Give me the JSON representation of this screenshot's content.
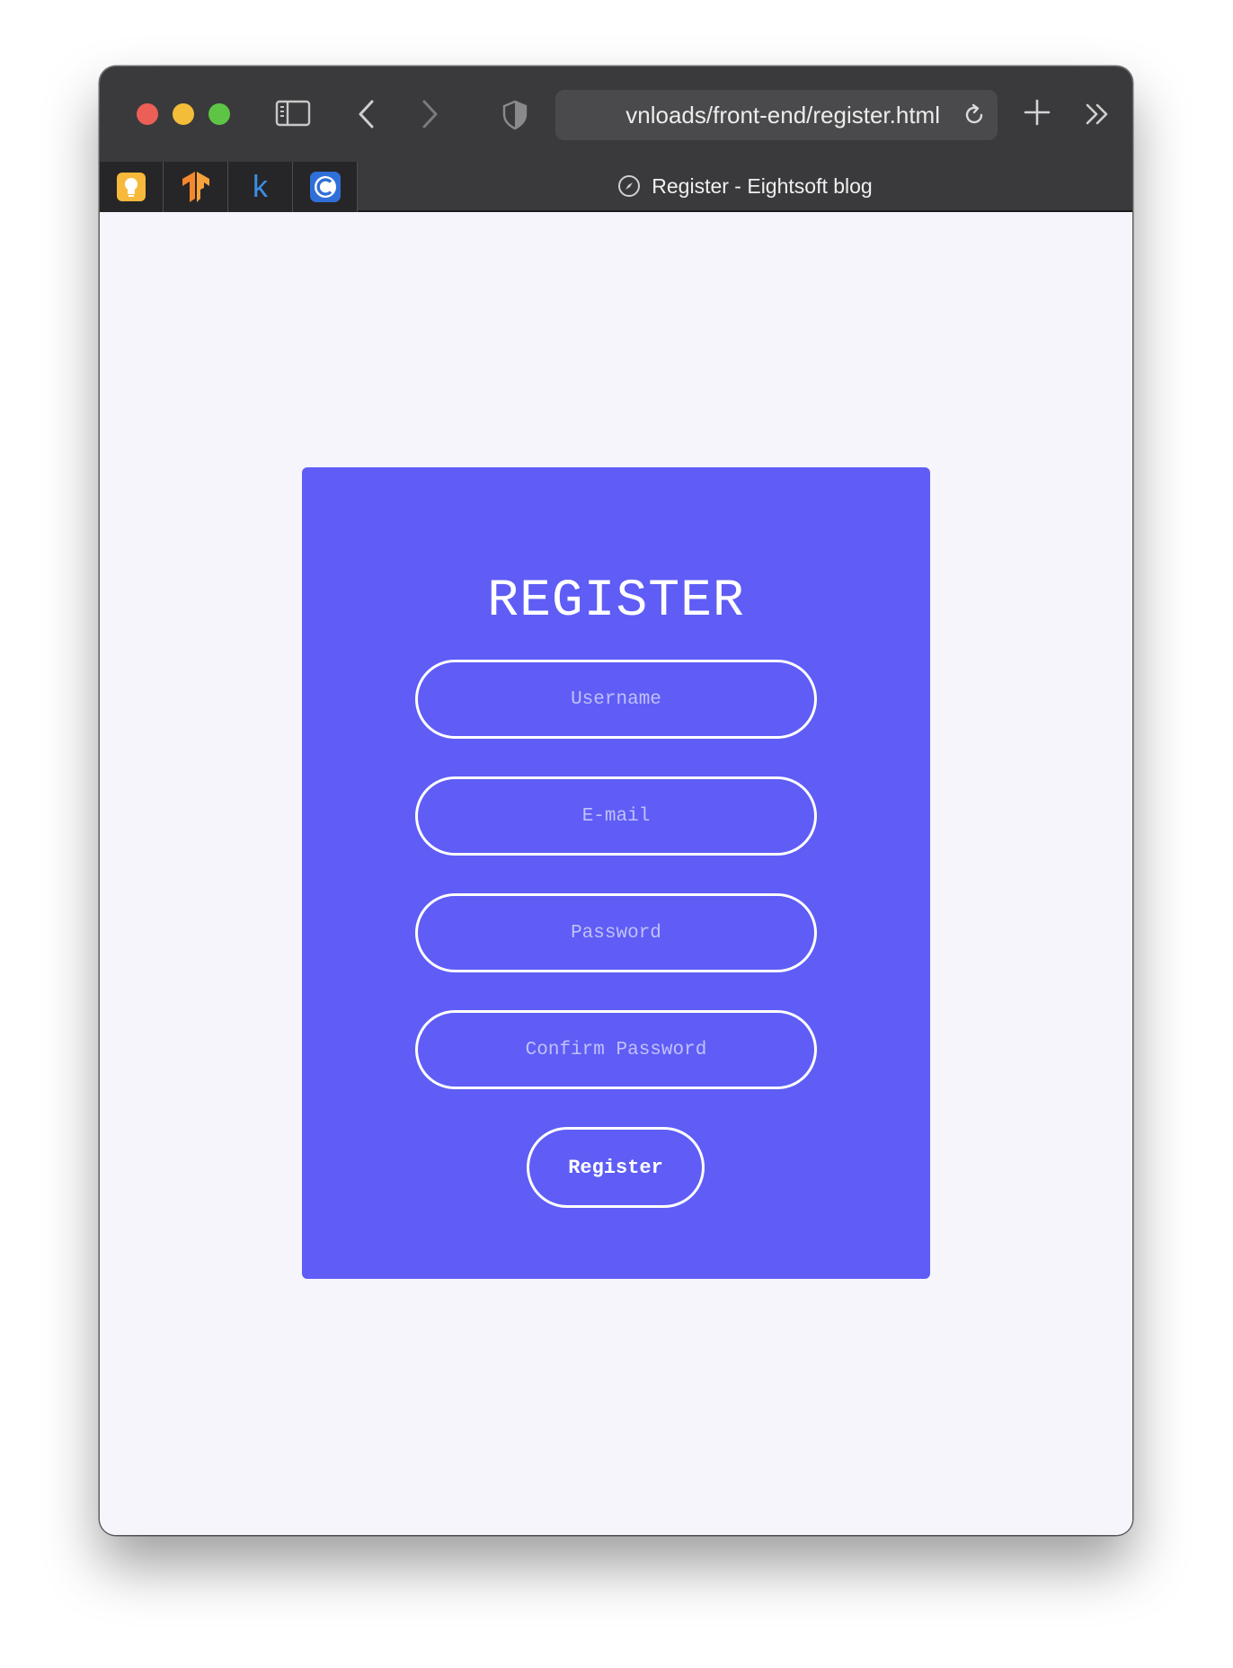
{
  "browser": {
    "url": "vnloads/front-end/register.html",
    "tab_title": "Register - Eightsoft blog",
    "pinned_tabs": [
      {
        "icon": "lightbulb-icon"
      },
      {
        "icon": "tensorflow-icon"
      },
      {
        "icon": "k-letter-icon",
        "glyph": "k"
      },
      {
        "icon": "c-letter-icon",
        "glyph": "C"
      }
    ]
  },
  "form": {
    "title": "REGISTER",
    "username_placeholder": "Username",
    "email_placeholder": "E-mail",
    "password_placeholder": "Password",
    "confirm_placeholder": "Confirm Password",
    "submit_label": "Register"
  },
  "colors": {
    "card": "#5f5df5",
    "page": "#f7f5fc",
    "toolbar": "#3a3a3c"
  }
}
